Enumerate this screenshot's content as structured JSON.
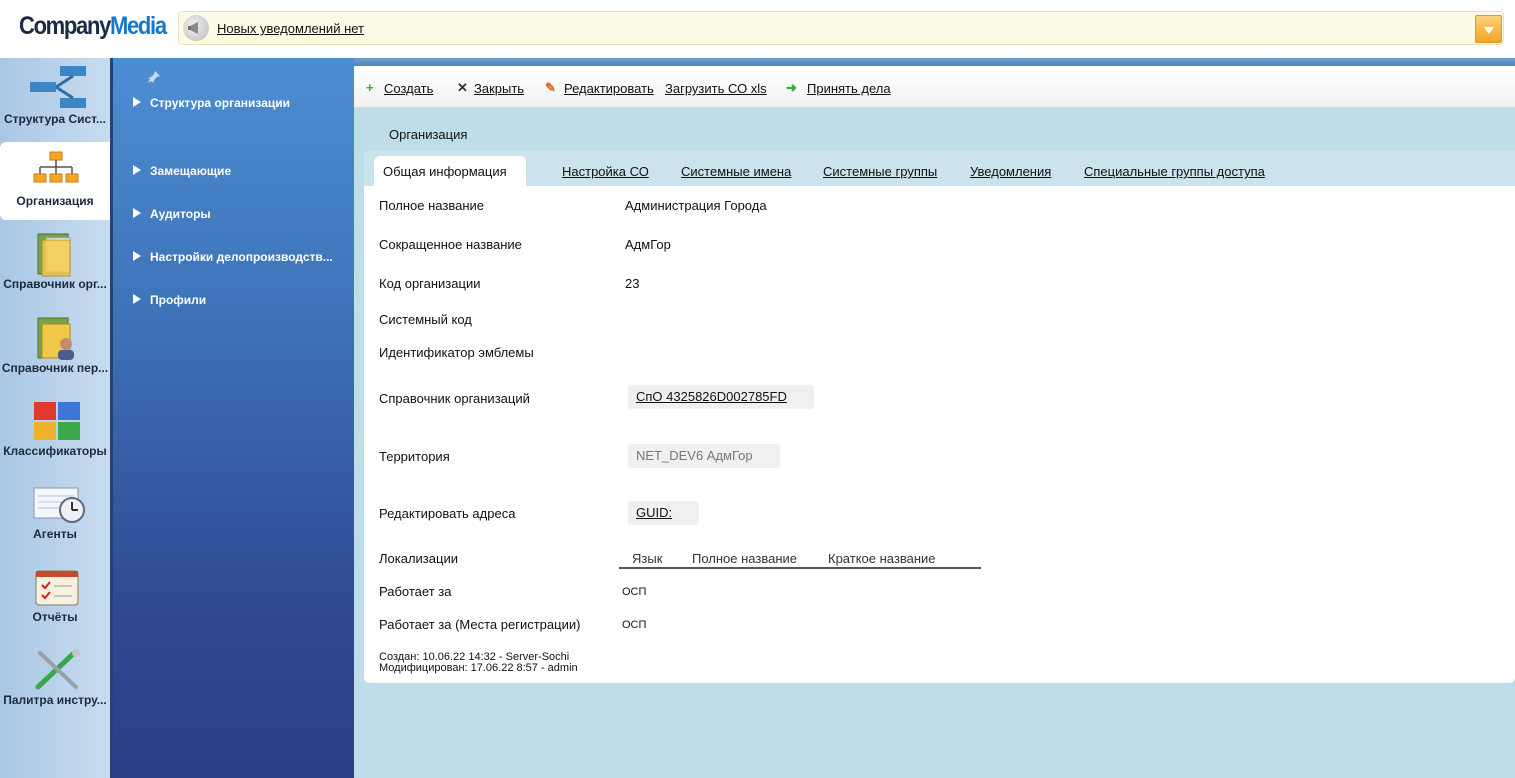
{
  "header": {
    "logo_company": "Company",
    "logo_media": "Media",
    "notification_text": "Новых уведомлений нет"
  },
  "iconbar": {
    "items": [
      {
        "label": "Структура Сист..."
      },
      {
        "label": "Организация"
      },
      {
        "label": "Справочник орг..."
      },
      {
        "label": "Справочник пер..."
      },
      {
        "label": "Классификаторы"
      },
      {
        "label": "Агенты"
      },
      {
        "label": "Отчёты"
      },
      {
        "label": "Палитра инстру..."
      }
    ]
  },
  "nav": {
    "items": [
      {
        "label": "Структура организации"
      },
      {
        "label": "Замещающие"
      },
      {
        "label": "Аудиторы"
      },
      {
        "label": "Настройки делопроизводств..."
      },
      {
        "label": "Профили"
      }
    ]
  },
  "toolbar": {
    "create": "Создать",
    "close": "Закрыть",
    "edit": "Редактировать",
    "upload": "Загрузить СО xls",
    "accept": "Принять дела"
  },
  "section": {
    "title": "Организация"
  },
  "tabs": [
    {
      "label": "Общая информация"
    },
    {
      "label": "Настройка СО"
    },
    {
      "label": "Системные имена"
    },
    {
      "label": "Системные группы"
    },
    {
      "label": "Уведомления"
    },
    {
      "label": "Специальные группы доступа"
    }
  ],
  "form": {
    "full_name_label": "Полное название",
    "full_name_value": "Администрация Города",
    "short_name_label": "Сокращенное название",
    "short_name_value": "АдмГор",
    "org_code_label": "Код организации",
    "org_code_value": "23",
    "system_code_label": "Системный код",
    "emblem_id_label": "Идентификатор эмблемы",
    "org_directory_label": "Справочник организаций",
    "org_directory_value": "СпО 4325826D002785FD",
    "territory_label": "Территория",
    "territory_value": "NET_DEV6 АдмГор",
    "edit_addresses_label": "Редактировать адреса",
    "edit_addresses_value": "GUID:",
    "localizations_label": "Локализации",
    "loc_col_lang": "Язык",
    "loc_col_full": "Полное название",
    "loc_col_short": "Краткое название",
    "works_for_label": "Работает за",
    "works_for_value": "ОСП",
    "works_for_reg_label": "Работает за (Места регистрации)",
    "works_for_reg_value": "ОСП",
    "created": "Создан: 10.06.22 14:32 - Server-Sochi",
    "modified": "Модифицирован: 17.06.22 8:57 -  admin"
  }
}
